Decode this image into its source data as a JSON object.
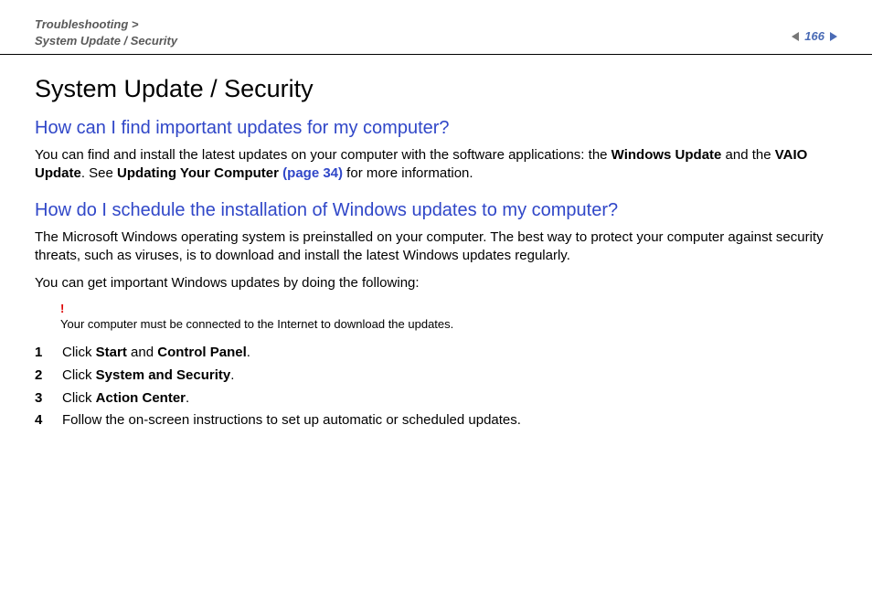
{
  "header": {
    "breadcrumb_line1": "Troubleshooting >",
    "breadcrumb_line2": "System Update / Security",
    "page_number": "166"
  },
  "main": {
    "title": "System Update / Security",
    "section1": {
      "heading": "How can I find important updates for my computer?",
      "para_pre": "You can find and install the latest updates on your computer with the software applications: the ",
      "bold1": "Windows Update",
      "mid1": " and the ",
      "bold2": "VAIO Update",
      "mid2": ". See ",
      "bold3": "Updating Your Computer ",
      "link": "(page 34)",
      "post": " for more information."
    },
    "section2": {
      "heading": "How do I schedule the installation of Windows updates to my computer?",
      "para1": "The Microsoft Windows operating system is preinstalled on your computer. The best way to protect your computer against security threats, such as viruses, is to download and install the latest Windows updates regularly.",
      "para2": "You can get important Windows updates by doing the following:",
      "note_bang": "!",
      "note_text": "Your computer must be connected to the Internet to download the updates.",
      "steps": [
        {
          "n": "1",
          "pre": "Click ",
          "b1": "Start",
          "mid": " and ",
          "b2": "Control Panel",
          "post": "."
        },
        {
          "n": "2",
          "pre": "Click ",
          "b1": "System and Security",
          "mid": "",
          "b2": "",
          "post": "."
        },
        {
          "n": "3",
          "pre": "Click ",
          "b1": "Action Center",
          "mid": "",
          "b2": "",
          "post": "."
        },
        {
          "n": "4",
          "pre": "Follow the on-screen instructions to set up automatic or scheduled updates.",
          "b1": "",
          "mid": "",
          "b2": "",
          "post": ""
        }
      ]
    }
  }
}
